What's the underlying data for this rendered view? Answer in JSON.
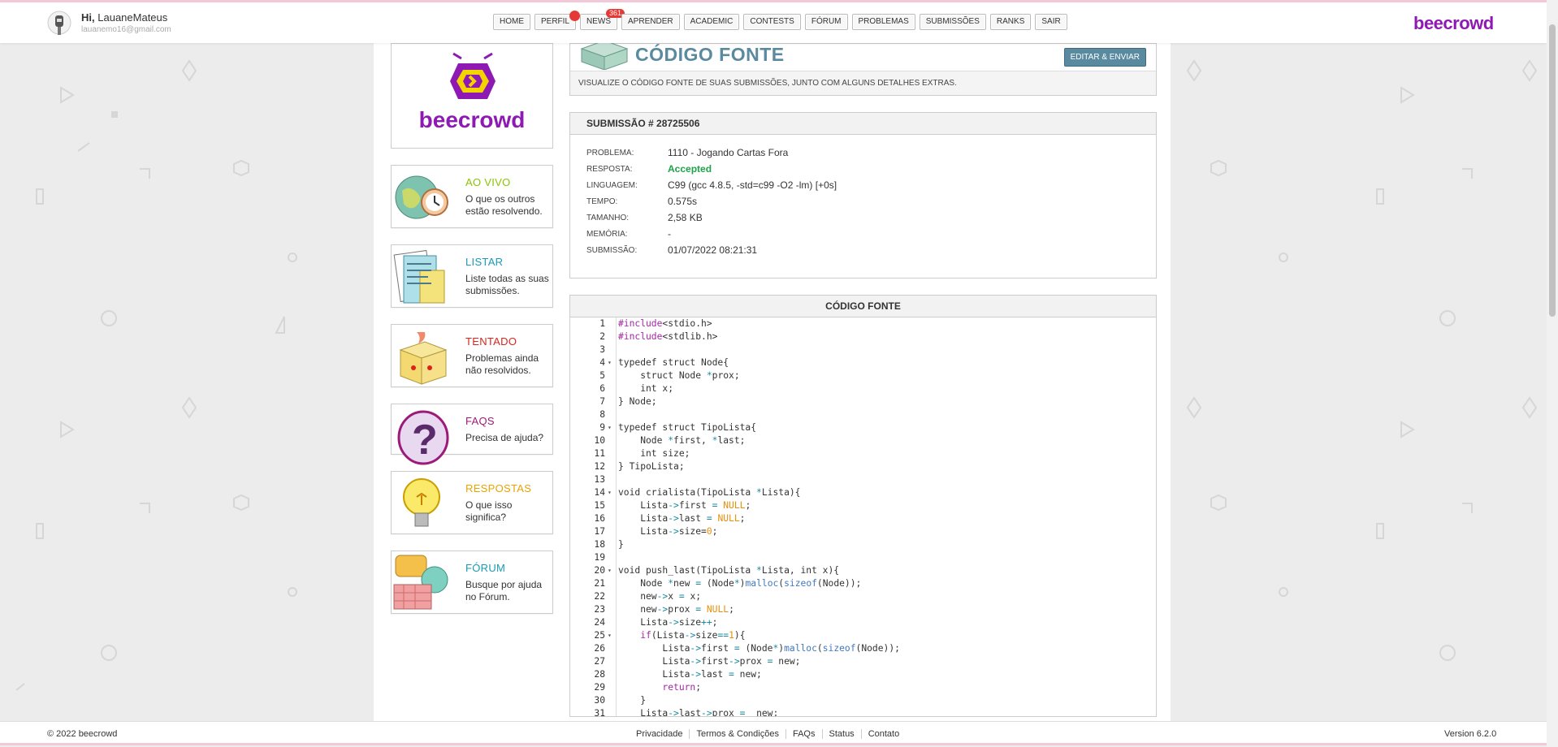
{
  "user": {
    "greeting": "Hi,",
    "name": "LauaneMateus",
    "email": "lauanemo16@gmail.com"
  },
  "nav": [
    {
      "label": "HOME"
    },
    {
      "label": "PERFIL",
      "dot": true
    },
    {
      "label": "NEWS",
      "badge": "361"
    },
    {
      "label": "APRENDER"
    },
    {
      "label": "ACADEMIC"
    },
    {
      "label": "CONTESTS"
    },
    {
      "label": "FÓRUM"
    },
    {
      "label": "PROBLEMAS"
    },
    {
      "label": "SUBMISSÕES"
    },
    {
      "label": "RANKS"
    },
    {
      "label": "SAIR"
    }
  ],
  "brand": "beecrowd",
  "logo_text": "beecrowd",
  "colors": {
    "brand": "#8e19b3",
    "accent": "#5a8aa0",
    "accepted": "#1fa34a"
  },
  "sidebar": [
    {
      "title": "AO VIVO",
      "desc": "O que os outros estão resolvendo.",
      "color": "#8bc400",
      "icon": "globe-clock-icon"
    },
    {
      "title": "LISTAR",
      "desc": "Liste todas as suas submissões.",
      "color": "#1a9bb3",
      "icon": "list-papers-icon"
    },
    {
      "title": "TENTADO",
      "desc": "Problemas ainda não resolvidos.",
      "color": "#d9241c",
      "icon": "box-icon"
    },
    {
      "title": "FAQS",
      "desc": "Precisa de ajuda?",
      "color": "#9c1a7a",
      "icon": "question-icon"
    },
    {
      "title": "RESPOSTAS",
      "desc": "O que isso significa?",
      "color": "#e8a400",
      "icon": "lightbulb-icon"
    },
    {
      "title": "FÓRUM",
      "desc": "Busque por ajuda no Fórum.",
      "color": "#1a9bb3",
      "icon": "chat-bubbles-icon"
    }
  ],
  "header": {
    "title": "CÓDIGO FONTE",
    "edit_button": "EDITAR & ENVIAR",
    "subtitle": "VISUALIZE O CÓDIGO FONTE DE SUAS SUBMISSÕES, JUNTO COM ALGUNS DETALHES EXTRAS."
  },
  "submission": {
    "heading": "SUBMISSÃO # 28725506",
    "rows": [
      {
        "key": "PROBLEMA:",
        "value": "1110 - Jogando Cartas Fora"
      },
      {
        "key": "RESPOSTA:",
        "value": "Accepted",
        "status": "ok"
      },
      {
        "key": "LINGUAGEM:",
        "value": "C99 (gcc 4.8.5, -std=c99 -O2 -lm) [+0s]"
      },
      {
        "key": "TEMPO:",
        "value": "0.575s"
      },
      {
        "key": "TAMANHO:",
        "value": "2,58 KB"
      },
      {
        "key": "MEMÓRIA:",
        "value": "-"
      },
      {
        "key": "SUBMISSÃO:",
        "value": "01/07/2022 08:21:31"
      }
    ]
  },
  "code": {
    "heading": "CÓDIGO FONTE",
    "lines": [
      "#include<stdio.h>",
      "#include<stdlib.h>",
      "",
      "typedef struct Node{",
      "    struct Node *prox;",
      "    int x;",
      "} Node;",
      "",
      "typedef struct TipoLista{",
      "    Node *first, *last;",
      "    int size;",
      "} TipoLista;",
      "",
      "void crialista(TipoLista *Lista){",
      "    Lista->first = NULL;",
      "    Lista->last = NULL;",
      "    Lista->size=0;",
      "}",
      "",
      "void push_last(TipoLista *Lista, int x){",
      "    Node *new = (Node*)malloc(sizeof(Node));",
      "    new->x = x;",
      "    new->prox = NULL;",
      "    Lista->size++;",
      "    if(Lista->size==1){",
      "        Lista->first = (Node*)malloc(sizeof(Node));",
      "        Lista->first->prox = new;",
      "        Lista->last = new;",
      "        return;",
      "    }",
      "    Lista->last->prox =  new;"
    ],
    "folds": [
      4,
      9,
      14,
      20,
      25
    ]
  },
  "footer": {
    "copyright": "© 2022 beecrowd",
    "links": [
      "Privacidade",
      "Termos & Condições",
      "FAQs",
      "Status",
      "Contato"
    ],
    "version": "Version 6.2.0"
  }
}
